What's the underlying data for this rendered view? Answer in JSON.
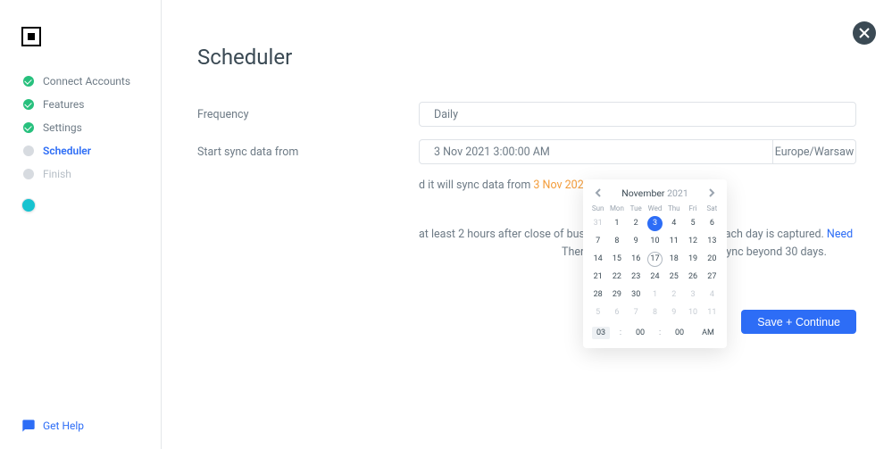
{
  "sidebar": {
    "steps": [
      {
        "label": "Connect Accounts",
        "state": "done"
      },
      {
        "label": "Features",
        "state": "done"
      },
      {
        "label": "Settings",
        "state": "done"
      },
      {
        "label": "Scheduler",
        "state": "current"
      },
      {
        "label": "Finish",
        "state": "pending"
      }
    ],
    "help_label": "Get Help"
  },
  "header": {
    "title": "Scheduler"
  },
  "form": {
    "frequency_label": "Frequency",
    "frequency_value": "Daily",
    "start_label": "Start sync data from",
    "start_value": "3 Nov 2021 3:00:00 AM",
    "timezone": "Europe/Warsaw"
  },
  "sync_info": {
    "prefix": "d it will sync data from ",
    "date": "3 Nov 2021"
  },
  "note": {
    "line1": "at least 2 hours after close of business to ensure all data for each day is captured. ",
    "link": "Need",
    "line2": "There is no additional charge to sync beyond 30 days."
  },
  "save_button": "Save + Continue",
  "calendar": {
    "month": "November",
    "year": "2021",
    "dow": [
      "Sun",
      "Mon",
      "Tue",
      "Wed",
      "Thu",
      "Fri",
      "Sat"
    ],
    "weeks": [
      [
        {
          "n": "31",
          "muted": true
        },
        {
          "n": "1"
        },
        {
          "n": "2"
        },
        {
          "n": "3",
          "selected": true
        },
        {
          "n": "4"
        },
        {
          "n": "5"
        },
        {
          "n": "6"
        }
      ],
      [
        {
          "n": "7"
        },
        {
          "n": "8"
        },
        {
          "n": "9"
        },
        {
          "n": "10"
        },
        {
          "n": "11"
        },
        {
          "n": "12"
        },
        {
          "n": "13"
        }
      ],
      [
        {
          "n": "14"
        },
        {
          "n": "15"
        },
        {
          "n": "16"
        },
        {
          "n": "17",
          "today": true
        },
        {
          "n": "18"
        },
        {
          "n": "19"
        },
        {
          "n": "20"
        }
      ],
      [
        {
          "n": "21"
        },
        {
          "n": "22"
        },
        {
          "n": "23"
        },
        {
          "n": "24"
        },
        {
          "n": "25"
        },
        {
          "n": "26"
        },
        {
          "n": "27"
        }
      ],
      [
        {
          "n": "28"
        },
        {
          "n": "29"
        },
        {
          "n": "30"
        },
        {
          "n": "1",
          "muted": true
        },
        {
          "n": "2",
          "muted": true
        },
        {
          "n": "3",
          "muted": true
        },
        {
          "n": "4",
          "muted": true
        }
      ],
      [
        {
          "n": "5",
          "muted": true
        },
        {
          "n": "6",
          "muted": true
        },
        {
          "n": "7",
          "muted": true
        },
        {
          "n": "8",
          "muted": true
        },
        {
          "n": "9",
          "muted": true
        },
        {
          "n": "10",
          "muted": true
        },
        {
          "n": "11",
          "muted": true
        }
      ]
    ],
    "time": {
      "hh": "03",
      "mm": "00",
      "ss": "00",
      "ampm": "AM"
    }
  }
}
